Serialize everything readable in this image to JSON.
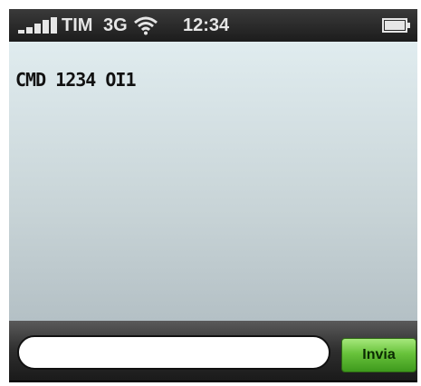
{
  "status_bar": {
    "carrier": "TIM",
    "network": "3G",
    "time": "12:34",
    "icons": [
      "signal-bars-icon",
      "wifi-icon",
      "battery-icon"
    ]
  },
  "conversation": {
    "message": "CMD 1234 OI1"
  },
  "compose": {
    "input_value": "",
    "send_label": "Invia"
  },
  "colors": {
    "send_button": "#5fbf2f",
    "background_top": "#e0ecef",
    "background_bottom": "#b4c0c5"
  }
}
